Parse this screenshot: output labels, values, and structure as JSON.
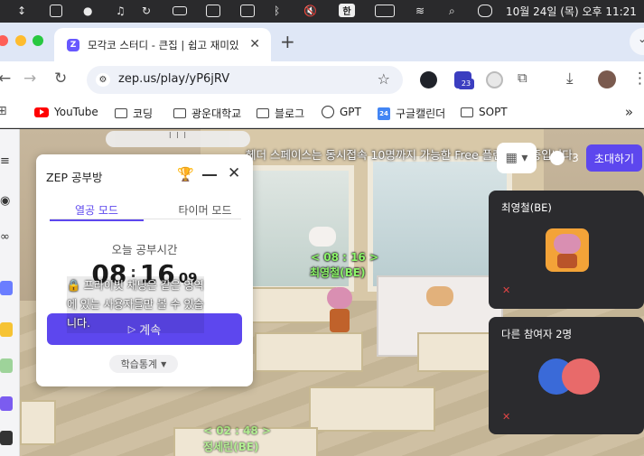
{
  "menubar": {
    "clock": "10월 24일 (목) 오후 11:21",
    "ime": "한",
    "icons": [
      "updown-arrow-icon",
      "stage-manager-icon",
      "notification-icon",
      "music-icon",
      "refresh-icon",
      "bed-icon",
      "grid-icon",
      "window-icon",
      "bluetooth-icon",
      "mute-icon",
      "ime-icon",
      "battery-icon",
      "wifi-icon",
      "control-center-icon"
    ]
  },
  "tab": {
    "title": "모각코 스터디 - 큰집 | 쉽고 재미있",
    "favicon": "Z"
  },
  "toolbar": {
    "url": "zep.us/play/yP6jRV",
    "ext_badge": "23"
  },
  "bookmarks": [
    {
      "label": "YouTube",
      "icon": "youtube-icon"
    },
    {
      "label": "코딩",
      "icon": "folder-icon"
    },
    {
      "label": "광운대학교",
      "icon": "folder-icon"
    },
    {
      "label": "블로그",
      "icon": "folder-icon"
    },
    {
      "label": "GPT",
      "icon": "openai-icon"
    },
    {
      "label": "구글캘린더",
      "icon": "calendar-icon"
    },
    {
      "label": "SOPT",
      "icon": "folder-icon"
    }
  ],
  "game": {
    "banner": "헤더 스페이스는 동시접속 10명까지 가능한 Free 플랜 사용 중입니다.",
    "people_count": "3",
    "invite_label": "초대하기",
    "player_timer": "< 08 : 16 >",
    "player_name": "최영철(BE)",
    "other_timer": "< 02 : 48 >",
    "other_name": "정세린(BE)",
    "privacy_text": "🔒 프라이빗 채팅은 같은 영역에 있는 사용자들만 볼 수 있습니다."
  },
  "study_panel": {
    "title": "ZEP 공부방",
    "tab_active": "열공 모드",
    "tab_inactive": "타이머 모드",
    "label": "오늘 공부시간",
    "hours": "08",
    "minutes": "16",
    "seconds": "09",
    "continue_label": "계속",
    "stats_label": "학습통계"
  },
  "participants": {
    "self_name": "최영철(BE)",
    "others_label": "다른 참여자 2명"
  },
  "colors": {
    "accent": "#5d47ee",
    "tag_green": "#8cf56a",
    "panel_dark": "#2b2b2e"
  }
}
